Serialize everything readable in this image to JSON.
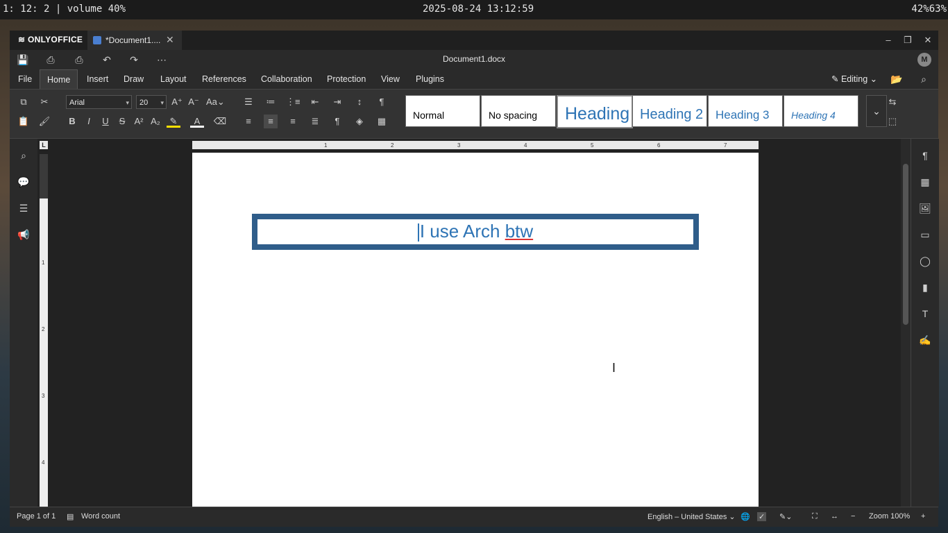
{
  "system_bar": {
    "left": "1: 12: 2 |  volume 40%",
    "center": "2025-08-24 13:12:59",
    "right": "42%63%"
  },
  "app": {
    "brand": "ONLYOFFICE",
    "tab_title": "*Document1....",
    "doc_title": "Document1.docx",
    "user_initial": "M",
    "accent_color": "#2e74b5"
  },
  "menu": {
    "tabs": [
      "File",
      "Home",
      "Insert",
      "Draw",
      "Layout",
      "References",
      "Collaboration",
      "Protection",
      "View",
      "Plugins"
    ],
    "active": "Home",
    "mode": "Editing"
  },
  "ribbon": {
    "font_name": "Arial",
    "font_size": "20",
    "styles": [
      "Normal",
      "No spacing",
      "Heading",
      "Heading 2",
      "Heading 3",
      "Heading 4"
    ]
  },
  "document": {
    "text_before": "I use Arch ",
    "text_misspelled": "btw"
  },
  "ruler": {
    "h_labels": [
      "1",
      "2",
      "3",
      "4",
      "5",
      "6",
      "7"
    ],
    "v_labels": [
      "1",
      "2",
      "3",
      "4"
    ],
    "corner": "L"
  },
  "status": {
    "page": "Page 1 of 1",
    "word_count": "Word count",
    "language": "English – United States",
    "zoom": "Zoom 100%"
  }
}
